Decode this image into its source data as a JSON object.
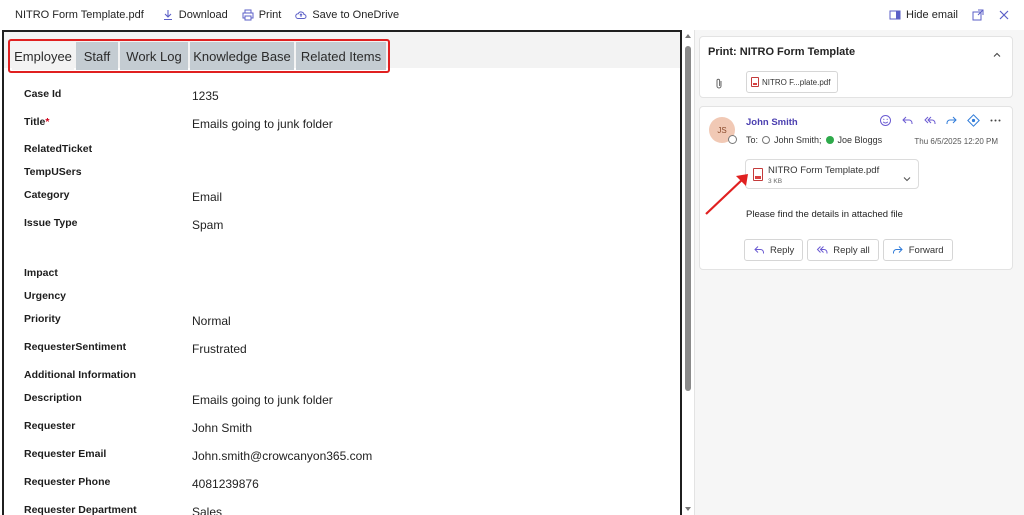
{
  "topbar": {
    "file_name": "NITRO Form Template.pdf",
    "download_label": "Download",
    "print_label": "Print",
    "save_label": "Save to OneDrive",
    "hide_email_label": "Hide email"
  },
  "tabs": [
    {
      "label": "Employee",
      "active": true
    },
    {
      "label": "Staff",
      "active": false
    },
    {
      "label": "Work Log",
      "active": false
    },
    {
      "label": "Knowledge Base",
      "active": false
    },
    {
      "label": "Related Items",
      "active": false
    }
  ],
  "form": {
    "fields": [
      {
        "label": "Case Id",
        "value": "1235",
        "required": false
      },
      {
        "label": "Title",
        "value": "Emails going to junk folder",
        "required": true
      },
      {
        "label": "RelatedTicket",
        "value": "",
        "required": false
      },
      {
        "label": "TempUSers",
        "value": "",
        "required": false
      },
      {
        "label": "Category",
        "value": "Email",
        "required": false
      },
      {
        "label": "Issue Type",
        "value": "Spam",
        "required": false
      },
      {
        "label": "Impact",
        "value": "",
        "required": false
      },
      {
        "label": "Urgency",
        "value": "",
        "required": false
      },
      {
        "label": "Priority",
        "value": "Normal",
        "required": false
      },
      {
        "label": "RequesterSentiment",
        "value": "Frustrated",
        "required": false
      },
      {
        "label": "Additional Information",
        "value": "",
        "required": false
      },
      {
        "label": "Description",
        "value": "Emails going to junk folder",
        "required": false
      },
      {
        "label": "Requester",
        "value": "John Smith",
        "required": false
      },
      {
        "label": "Requester Email",
        "value": "John.smith@crowcanyon365.com",
        "required": false
      },
      {
        "label": "Requester Phone",
        "value": "4081239876",
        "required": false
      },
      {
        "label": "Requester Department",
        "value": "Sales",
        "required": false
      }
    ],
    "required_marker": "*"
  },
  "panel": {
    "print_title": "Print: NITRO Form Template",
    "attachment_chip": "NITRO F...plate.pdf",
    "message": {
      "avatar_initials": "JS",
      "sender": "John Smith",
      "to_prefix": "To:",
      "recipient_1": "John Smith;",
      "recipient_2": "Joe Bloggs",
      "date": "Thu 6/5/2025 12:20 PM",
      "attachment_name": "NITRO Form Template.pdf",
      "attachment_size": "3 KB",
      "body": "Please find the details in attached file",
      "reply_label": "Reply",
      "reply_all_label": "Reply all",
      "forward_label": "Forward"
    }
  },
  "colors": {
    "highlight_outline": "#e02020",
    "sender_name": "#4b3fb0",
    "accent_purple": "#6b5bd2",
    "annotation_arrow": "#e02020"
  }
}
